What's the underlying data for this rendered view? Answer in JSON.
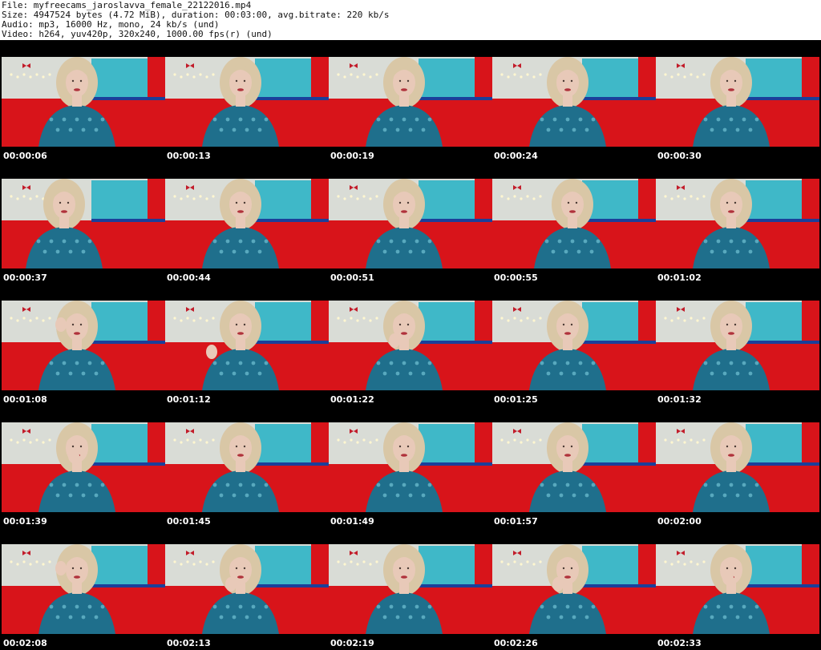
{
  "header": {
    "file_line": "File: myfreecams_jaroslavva_female_22122016.mp4",
    "size_line": "Size: 4947524 bytes (4.72 MiB), duration: 00:03:00, avg.bitrate: 220 kb/s",
    "audio_line": "Audio: mp3, 16000 Hz, mono, 24 kb/s (und)",
    "video_line": "Video: h264, yuv420p, 320x240, 1000.00 fps(r) (und)"
  },
  "thumbnails": [
    {
      "time": "00:00:06",
      "pose": "center"
    },
    {
      "time": "00:00:13",
      "pose": "center"
    },
    {
      "time": "00:00:19",
      "pose": "center"
    },
    {
      "time": "00:00:24",
      "pose": "center"
    },
    {
      "time": "00:00:30",
      "pose": "center"
    },
    {
      "time": "00:00:37",
      "pose": "left"
    },
    {
      "time": "00:00:44",
      "pose": "center"
    },
    {
      "time": "00:00:51",
      "pose": "center"
    },
    {
      "time": "00:00:55",
      "pose": "tilt"
    },
    {
      "time": "00:01:02",
      "pose": "center"
    },
    {
      "time": "00:01:08",
      "pose": "hand-head"
    },
    {
      "time": "00:01:12",
      "pose": "hand-hair"
    },
    {
      "time": "00:01:22",
      "pose": "hand-chin"
    },
    {
      "time": "00:01:25",
      "pose": "center"
    },
    {
      "time": "00:01:32",
      "pose": "center"
    },
    {
      "time": "00:01:39",
      "pose": "hand-mouth"
    },
    {
      "time": "00:01:45",
      "pose": "center"
    },
    {
      "time": "00:01:49",
      "pose": "center"
    },
    {
      "time": "00:01:57",
      "pose": "center"
    },
    {
      "time": "00:02:00",
      "pose": "center"
    },
    {
      "time": "00:02:08",
      "pose": "hand-head"
    },
    {
      "time": "00:02:13",
      "pose": "hand-chin"
    },
    {
      "time": "00:02:19",
      "pose": "center"
    },
    {
      "time": "00:02:26",
      "pose": "hand-chin"
    },
    {
      "time": "00:02:33",
      "pose": "hand-mouth"
    }
  ],
  "colors": {
    "sofa": "#d8141a",
    "wall": "#d9dcd6",
    "panel": "#3fb8c8",
    "hair": "#d9c7a6",
    "skin": "#e8c9b8",
    "blouse": "#1f6f8c",
    "sheet_background": "#000000"
  }
}
